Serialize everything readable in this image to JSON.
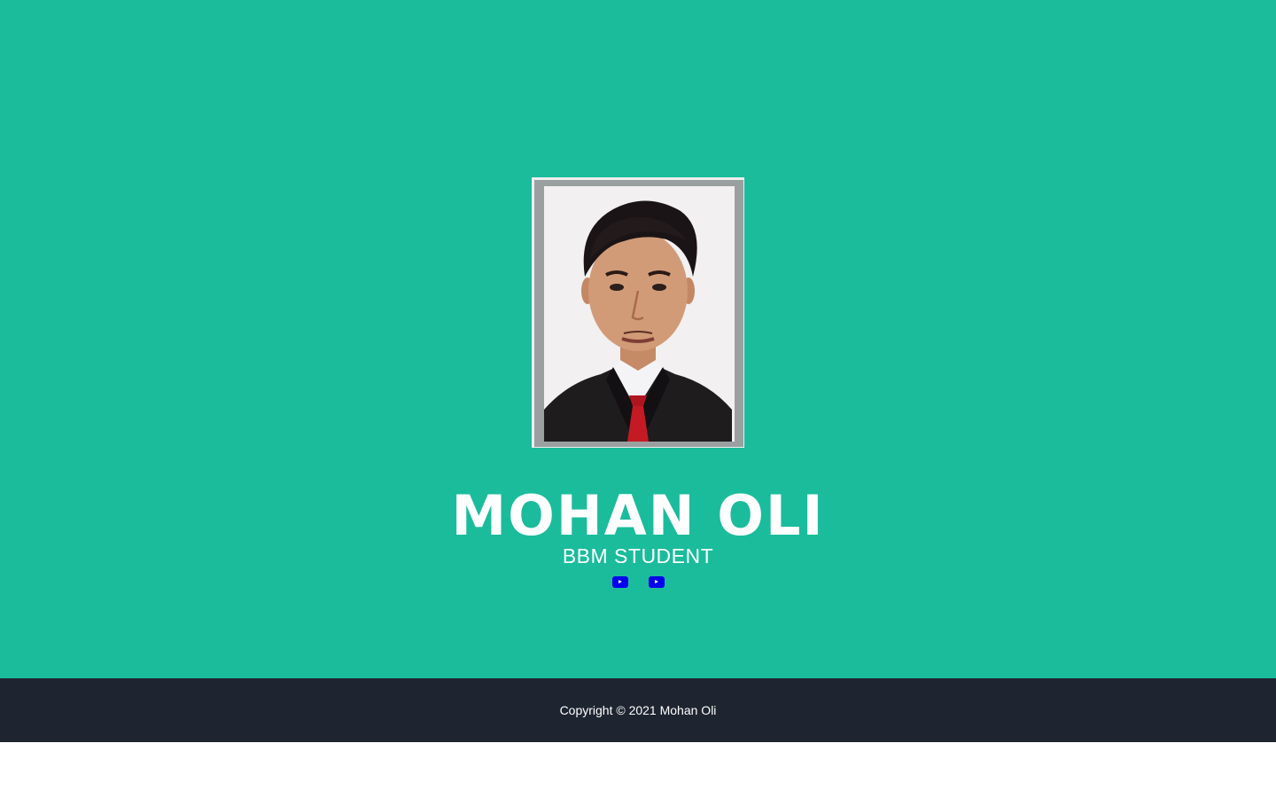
{
  "profile": {
    "name": "MOHAN OLI",
    "role": "BBM STUDENT",
    "photo_alt": "profile photo"
  },
  "social": {
    "links": [
      {
        "icon": "video-play-icon"
      },
      {
        "icon": "video-play-icon"
      }
    ]
  },
  "footer": {
    "copyright": "Copyright © 2021 Mohan Oli"
  },
  "colors": {
    "hero_background": "#1abc9c",
    "footer_background": "#1e2530",
    "text": "#ffffff",
    "link_icon": "#0000ee"
  }
}
